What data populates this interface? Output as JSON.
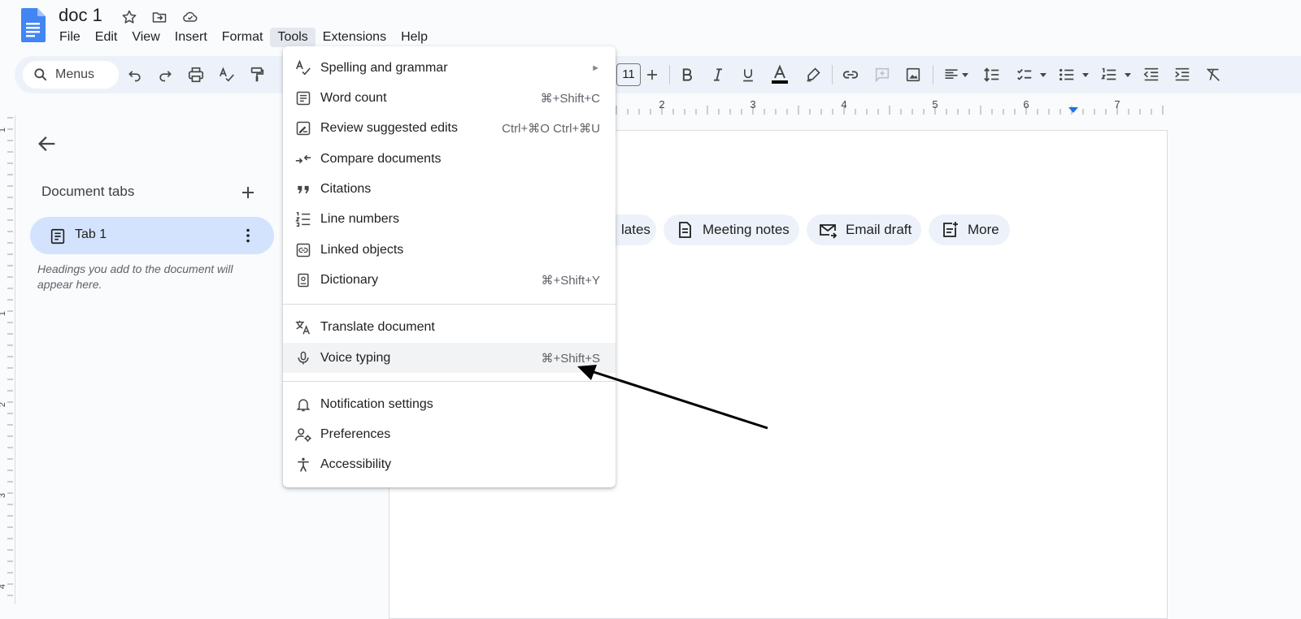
{
  "app": {
    "doc_title": "doc 1",
    "menus": [
      "File",
      "Edit",
      "View",
      "Insert",
      "Format",
      "Tools",
      "Extensions",
      "Help"
    ],
    "active_menu": "Tools"
  },
  "toolbar": {
    "search_label": "Menus",
    "font_size": "11"
  },
  "ruler": {
    "labels": [
      "2",
      "3",
      "4",
      "5",
      "6",
      "7"
    ],
    "vertical_labels": [
      "1",
      "1",
      "2",
      "3",
      "4"
    ]
  },
  "sidebar": {
    "title": "Document tabs",
    "tab_label": "Tab 1",
    "hint": "Headings you add to the document will appear here."
  },
  "chips": [
    {
      "label": "lates",
      "icon": "template-icon"
    },
    {
      "label": "Meeting notes",
      "icon": "document-icon"
    },
    {
      "label": "Email draft",
      "icon": "email-icon"
    },
    {
      "label": "More",
      "icon": "more-doc-icon"
    }
  ],
  "tools_menu": {
    "items": [
      {
        "label": "Spelling and grammar",
        "shortcut": "",
        "submenu": true,
        "icon": "spellcheck-icon"
      },
      {
        "label": "Word count",
        "shortcut": "⌘+Shift+C",
        "icon": "word-count-icon"
      },
      {
        "label": "Review suggested edits",
        "shortcut": "Ctrl+⌘O Ctrl+⌘U",
        "icon": "review-edits-icon"
      },
      {
        "label": "Compare documents",
        "shortcut": "",
        "icon": "compare-icon"
      },
      {
        "label": "Citations",
        "shortcut": "",
        "icon": "quote-icon"
      },
      {
        "label": "Line numbers",
        "shortcut": "",
        "icon": "line-numbers-icon"
      },
      {
        "label": "Linked objects",
        "shortcut": "",
        "icon": "link-box-icon"
      },
      {
        "label": "Dictionary",
        "shortcut": "⌘+Shift+Y",
        "icon": "dictionary-icon"
      },
      {
        "label": "Translate document",
        "shortcut": "",
        "icon": "translate-icon"
      },
      {
        "label": "Voice typing",
        "shortcut": "⌘+Shift+S",
        "icon": "mic-icon",
        "highlighted": true
      },
      {
        "label": "Notification settings",
        "shortcut": "",
        "icon": "bell-icon"
      },
      {
        "label": "Preferences",
        "shortcut": "",
        "icon": "preferences-icon"
      },
      {
        "label": "Accessibility",
        "shortcut": "",
        "icon": "accessibility-icon"
      }
    ],
    "submenu_arrow": "►"
  },
  "colors": {
    "menu_highlight": "#f1f3f4",
    "tab_active": "#d3e3fd",
    "toolbar_bg": "#edf2fa",
    "doc_blue": "#4285f4"
  }
}
